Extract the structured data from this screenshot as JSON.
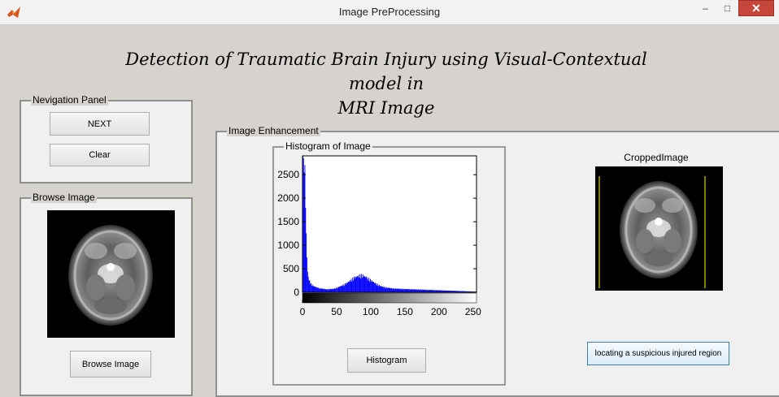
{
  "window": {
    "title": "Image PreProcessing",
    "minimize": "–",
    "maximize": "□",
    "close": "✕",
    "app_icon": "matlab-icon"
  },
  "main_title": {
    "line1": "Detection of Traumatic Brain Injury  using Visual-Contextual model in",
    "line2": "MRI Image"
  },
  "navigation_panel": {
    "label": "Nevigation Panel",
    "next_button": "NEXT",
    "clear_button": "Clear"
  },
  "browse_panel": {
    "label": "Browse Image",
    "browse_button": "Browse Image"
  },
  "enhancement_panel": {
    "label": "Image Enhancement",
    "histogram_panel_label": "Histogram of Image",
    "histogram_button": "Histogram",
    "cropped_title": "CroppedImage",
    "locate_button": "locating a suspicious injured region"
  },
  "colors": {
    "histogram": "#0000ff",
    "crop_lines": "#ffff00",
    "close_button": "#c7463b"
  },
  "chart_data": {
    "type": "bar",
    "x_ticks": [
      0,
      50,
      100,
      150,
      200,
      250
    ],
    "y_ticks": [
      0,
      500,
      1000,
      1500,
      2000,
      2500
    ],
    "xlim": [
      0,
      255
    ],
    "ylim": [
      0,
      2900
    ],
    "x": [
      0,
      1,
      2,
      3,
      4,
      5,
      6,
      7,
      8,
      10,
      12,
      15,
      20,
      25,
      30,
      35,
      40,
      45,
      50,
      55,
      60,
      65,
      70,
      75,
      80,
      85,
      88,
      92,
      95,
      100,
      105,
      110,
      115,
      120,
      125,
      130,
      140,
      150,
      160,
      170,
      180,
      190,
      200,
      210,
      220,
      230,
      240,
      250,
      255
    ],
    "values": [
      2900,
      2850,
      2750,
      2400,
      1800,
      1150,
      700,
      420,
      300,
      220,
      170,
      130,
      100,
      80,
      70,
      60,
      65,
      70,
      90,
      120,
      150,
      190,
      240,
      290,
      320,
      340,
      335,
      310,
      280,
      240,
      190,
      150,
      120,
      100,
      90,
      80,
      70,
      65,
      60,
      55,
      50,
      45,
      40,
      35,
      30,
      25,
      20,
      15,
      10
    ],
    "colorbar": "grayscale 0-255"
  }
}
